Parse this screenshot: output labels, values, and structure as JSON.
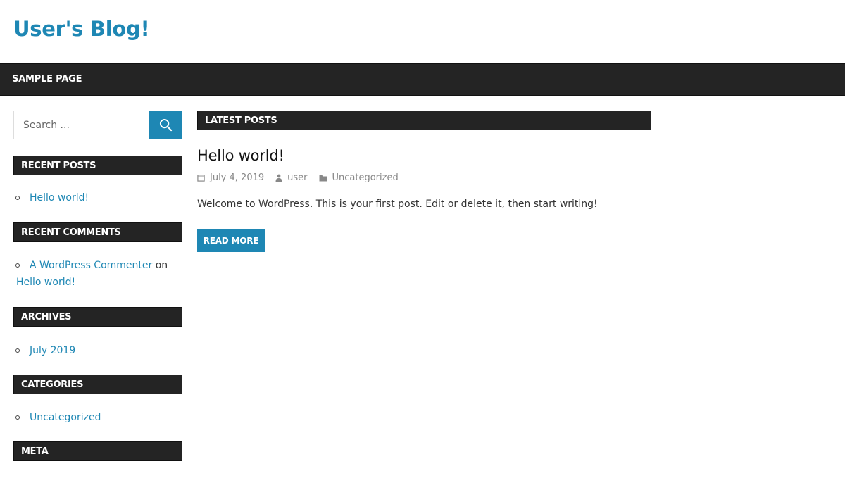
{
  "site": {
    "title": "User's Blog!"
  },
  "nav": {
    "items": [
      {
        "label": "SAMPLE PAGE"
      }
    ]
  },
  "sidebar": {
    "search": {
      "placeholder": "Search ...",
      "icon": "search-icon"
    },
    "recent_posts": {
      "title": "RECENT POSTS",
      "items": [
        "Hello world!"
      ]
    },
    "recent_comments": {
      "title": "RECENT COMMENTS",
      "items": [
        {
          "author": "A WordPress Commenter",
          "connector": "on",
          "post": "Hello world!"
        }
      ]
    },
    "archives": {
      "title": "ARCHIVES",
      "items": [
        "July 2019"
      ]
    },
    "categories": {
      "title": "CATEGORIES",
      "items": [
        "Uncategorized"
      ]
    },
    "meta": {
      "title": "META"
    }
  },
  "main": {
    "section_title": "LATEST POSTS",
    "post": {
      "title": "Hello world!",
      "date": "July 4, 2019",
      "author": "user",
      "category": "Uncategorized",
      "excerpt": "Welcome to WordPress. This is your first post. Edit or delete it, then start writing!",
      "read_more": "READ MORE"
    }
  },
  "colors": {
    "accent": "#1e87b4",
    "dark_bar": "#242424",
    "meta_text": "#888888"
  }
}
